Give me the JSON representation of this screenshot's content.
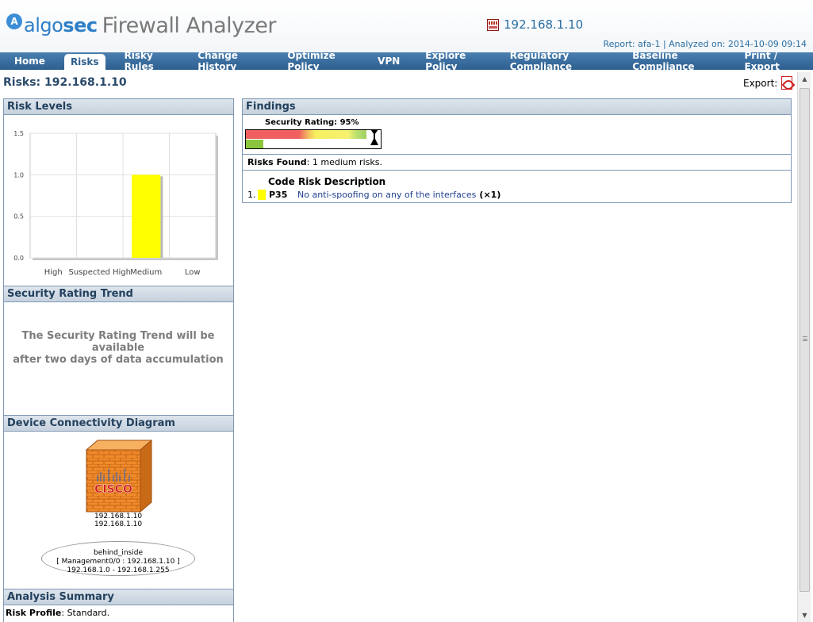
{
  "header": {
    "logo_letter": "A",
    "logo_algo": "algo",
    "logo_sec": "sec",
    "product_name": "Firewall Analyzer",
    "device_ip": "192.168.1.10",
    "report_line": "Report: afa-1 | Analyzed on: 2014-10-09 09:14"
  },
  "nav": {
    "items": [
      {
        "label": "Home"
      },
      {
        "label": "Risks"
      },
      {
        "label": "Risky Rules"
      },
      {
        "label": "Change History"
      },
      {
        "label": "Optimize Policy"
      },
      {
        "label": "VPN"
      },
      {
        "label": "Explore Policy"
      },
      {
        "label": "Regulatory Compliance"
      },
      {
        "label": "Baseline Compliance"
      },
      {
        "label": "Print / Export"
      }
    ],
    "active_index": 1
  },
  "page": {
    "title": "Risks: 192.168.1.10",
    "export_label": "Export:"
  },
  "risk_levels": {
    "title": "Risk Levels"
  },
  "chart_data": {
    "type": "bar",
    "categories": [
      "High",
      "Suspected High",
      "Medium",
      "Low"
    ],
    "values": [
      0,
      0,
      1,
      0
    ],
    "bar_colors": [
      "#ff3333",
      "#ff9933",
      "#ffff00",
      "#33aa33"
    ],
    "y_ticks": [
      "0.0",
      "0.5",
      "1.0",
      "1.5"
    ],
    "ylim": [
      0,
      1.5
    ],
    "grid": true
  },
  "trend": {
    "title": "Security Rating Trend",
    "message_line1": "The Security Rating Trend will be available",
    "message_line2": "after two days of data accumulation"
  },
  "diagram": {
    "title": "Device Connectivity Diagram",
    "device_brand": "CISCO",
    "device_ip_1": "192.168.1.10",
    "device_ip_2": "192.168.1.10",
    "network_name": "behind_inside",
    "network_iface": "[ Management0/0 : 192.168.1.10 ]",
    "network_range": "192.168.1.0 - 192.168.1.255"
  },
  "summary": {
    "title": "Analysis Summary",
    "profile_label": "Risk Profile",
    "profile_value": ": Standard."
  },
  "findings": {
    "title": "Findings",
    "rating_label": "Security Rating: 95%",
    "rating_value": 95,
    "risks_found_label": "Risks Found",
    "risks_found_value": ": 1 medium risks.",
    "table_header": "Code Risk Description",
    "risks": [
      {
        "num": "1.",
        "code": "P35",
        "description": "No anti-spoofing on any of the interfaces",
        "count": "(×1)",
        "color": "#ffff00"
      }
    ]
  }
}
